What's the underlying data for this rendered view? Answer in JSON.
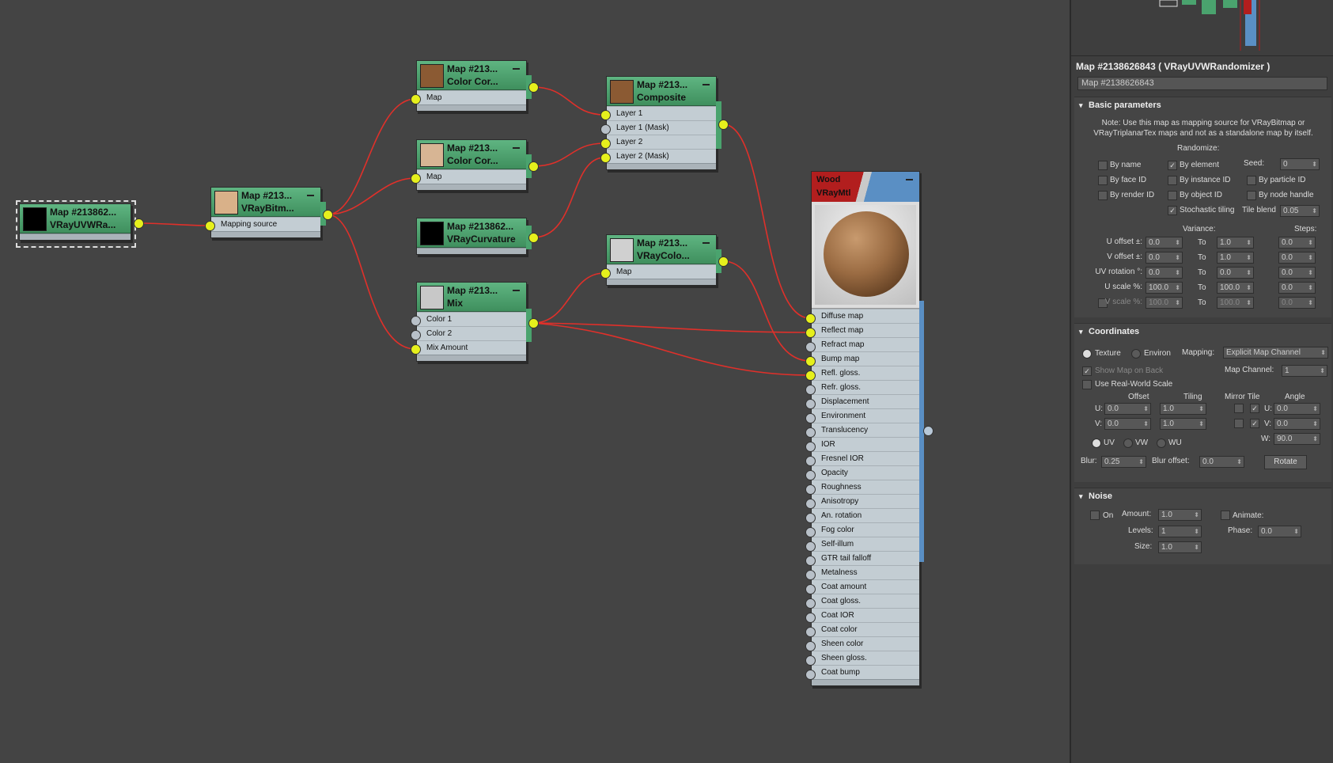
{
  "nodes": {
    "uvw": {
      "name": "Map #213862...",
      "type": "VRayUVWRa...",
      "swatch": "#000000"
    },
    "bitmap": {
      "name": "Map #213...",
      "type": "VRayBitm...",
      "swatch": "#d9b189",
      "port": "Mapping source"
    },
    "cc1": {
      "name": "Map #213...",
      "type": "Color Cor...",
      "swatch": "#8b5a33",
      "port": "Map"
    },
    "cc2": {
      "name": "Map #213...",
      "type": "Color Cor...",
      "swatch": "#d7b594",
      "port": "Map"
    },
    "curv": {
      "name": "Map #213862...",
      "type": "VRayCurvature",
      "swatch": "#000000"
    },
    "mix": {
      "name": "Map #213...",
      "type": "Mix",
      "swatch": "#c8c8c8",
      "ports": [
        "Color 1",
        "Color 2",
        "Mix Amount"
      ]
    },
    "comp": {
      "name": "Map #213...",
      "type": "Composite",
      "swatch": "#8b5a33",
      "ports": [
        "Layer 1",
        "Layer 1 (Mask)",
        "Layer 2",
        "Layer 2 (Mask)"
      ]
    },
    "vcol": {
      "name": "Map #213...",
      "type": "VRayColo...",
      "swatch": "#d0d0d0",
      "port": "Map"
    },
    "wood": {
      "name": "Wood",
      "type": "VRayMtl",
      "ports": [
        "Diffuse map",
        "Reflect map",
        "Refract map",
        "Bump map",
        "Refl. gloss.",
        "Refr. gloss.",
        "Displacement",
        "Environment",
        "Translucency",
        "IOR",
        "Fresnel IOR",
        "Opacity",
        "Roughness",
        "Anisotropy",
        "An. rotation",
        "Fog color",
        "Self-illum",
        "GTR tail falloff",
        "Metalness",
        "Coat amount",
        "Coat gloss.",
        "Coat IOR",
        "Coat color",
        "Sheen color",
        "Sheen gloss.",
        "Coat bump"
      ]
    }
  },
  "panel": {
    "title": "Map #2138626843  ( VRayUVWRandomizer )",
    "name_value": "Map #2138626843",
    "basic": {
      "header": "Basic parameters",
      "note": "Note: Use this map as mapping source for VRayBitmap or VRayTriplanarTex maps and not as a standalone map by itself.",
      "randomize": "Randomize:",
      "by_name": "By name",
      "by_element": "By element",
      "seed_label": "Seed:",
      "seed": "0",
      "by_face": "By face ID",
      "by_instance": "By instance ID",
      "by_particle": "By particle ID",
      "by_render": "By render ID",
      "by_object": "By object ID",
      "by_node": "By node handle",
      "stochastic": "Stochastic tiling",
      "tile_blend_label": "Tile blend",
      "tile_blend": "0.05",
      "variance": "Variance:",
      "steps": "Steps:",
      "to": "To",
      "rows": [
        {
          "label": "U offset ±:",
          "from": "0.0",
          "to": "1.0",
          "steps": "0.0"
        },
        {
          "label": "V offset ±:",
          "from": "0.0",
          "to": "1.0",
          "steps": "0.0"
        },
        {
          "label": "UV rotation °:",
          "from": "0.0",
          "to": "0.0",
          "steps": "0.0"
        },
        {
          "label": "U scale %:",
          "from": "100.0",
          "to": "100.0",
          "steps": "0.0"
        },
        {
          "label": "V scale %:",
          "from": "100.0",
          "to": "100.0",
          "steps": "0.0"
        }
      ],
      "check_mark": "✓"
    },
    "coords": {
      "header": "Coordinates",
      "texture": "Texture",
      "environ": "Environ",
      "mapping_label": "Mapping:",
      "mapping": "Explicit Map Channel",
      "show_back": "Show Map on Back",
      "map_channel_label": "Map Channel:",
      "map_channel": "1",
      "real_world": "Use Real-World Scale",
      "offset": "Offset",
      "tiling": "Tiling",
      "mirror_tile": "Mirror Tile",
      "angle": "Angle",
      "u": "U:",
      "v": "V:",
      "w": "W:",
      "u_offset": "0.0",
      "u_tiling": "1.0",
      "u_angle": "0.0",
      "v_offset": "0.0",
      "v_tiling": "1.0",
      "v_angle": "0.0",
      "w_angle": "90.0",
      "uv": "UV",
      "vw": "VW",
      "wu": "WU",
      "blur_label": "Blur:",
      "blur": "0.25",
      "blur_offset_label": "Blur offset:",
      "blur_offset": "0.0",
      "rotate": "Rotate"
    },
    "noise": {
      "header": "Noise",
      "on": "On",
      "amount_label": "Amount:",
      "amount": "1.0",
      "animate": "Animate:",
      "levels_label": "Levels:",
      "levels": "1",
      "phase_label": "Phase:",
      "phase": "0.0",
      "size_label": "Size:",
      "size": "1.0"
    }
  },
  "colors": {
    "wire": "#e0302a",
    "node_header": "#4fa571",
    "pin_active": "#e6f01c"
  }
}
